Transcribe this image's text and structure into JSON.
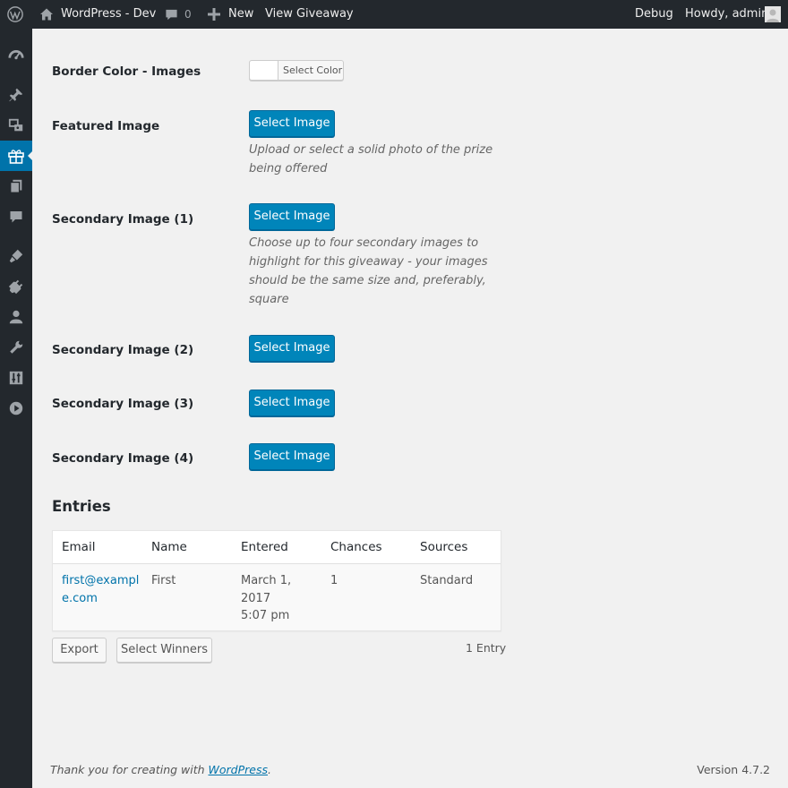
{
  "adminbar": {
    "site_name": "WordPress - Dev",
    "comments_count": "0",
    "new_label": "New",
    "view_label": "View Giveaway",
    "debug_label": "Debug",
    "howdy_label": "Howdy, admin"
  },
  "sidebar": {
    "items": [
      {
        "icon": "dashboard-icon"
      },
      {
        "icon": "pin-icon"
      },
      {
        "icon": "media-icon"
      },
      {
        "icon": "gift-icon",
        "current": true
      },
      {
        "icon": "pages-icon"
      },
      {
        "icon": "comments-icon"
      },
      {
        "icon": "appearance-icon"
      },
      {
        "icon": "plugins-icon"
      },
      {
        "icon": "users-icon"
      },
      {
        "icon": "tools-icon"
      },
      {
        "icon": "settings-icon"
      },
      {
        "icon": "play-icon"
      }
    ]
  },
  "form": {
    "border_color_label": "Border Color - Images",
    "select_color_label": "Select Color",
    "featured_label": "Featured Image",
    "featured_desc": "Upload or select a solid photo of the prize being offered",
    "secondary1_label": "Secondary Image (1)",
    "secondary1_desc": "Choose up to four secondary images to highlight for this giveaway - your images should be the same size and, preferably, square",
    "secondary2_label": "Secondary Image (2)",
    "secondary3_label": "Secondary Image (3)",
    "secondary4_label": "Secondary Image (4)",
    "select_image_label": "Select Image"
  },
  "entries": {
    "title": "Entries",
    "columns": [
      "Email",
      "Name",
      "Entered",
      "Chances",
      "Sources"
    ],
    "rows": [
      {
        "email_line1": "first@exampl",
        "email_line2": "e.com",
        "name": "First",
        "entered_line1": "March 1,",
        "entered_line2": "2017",
        "entered_line3": "5:07 pm",
        "chances": "1",
        "sources": "Standard"
      }
    ],
    "export_label": "Export",
    "select_winners_label": "Select Winners",
    "count_label": "1 Entry"
  },
  "footer": {
    "thanks_prefix": "Thank you for creating with ",
    "thanks_link": "WordPress",
    "thanks_suffix": ".",
    "version": "Version 4.7.2"
  },
  "colors": {
    "primary": "#0085ba",
    "adminbar": "#23282d",
    "link": "#0073aa"
  }
}
